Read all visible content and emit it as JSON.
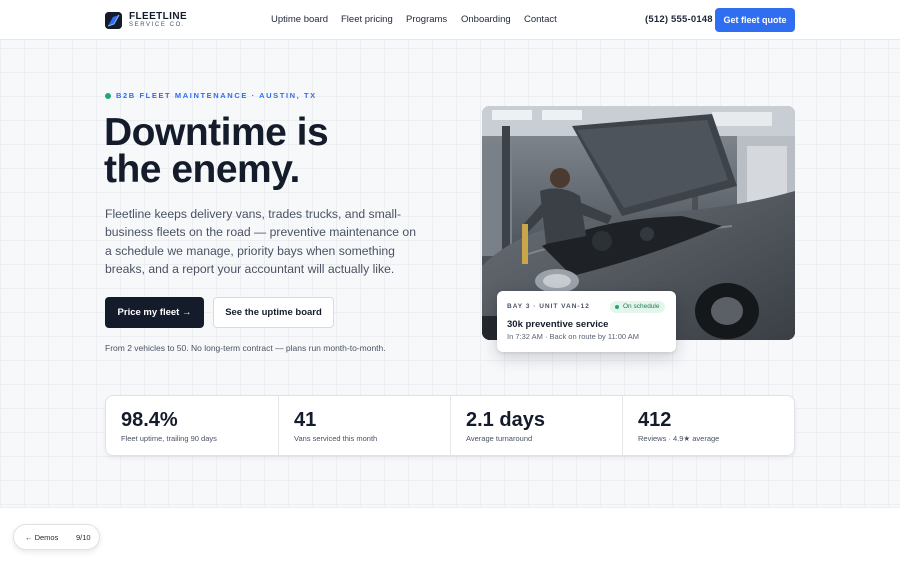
{
  "nav": {
    "logo_name": "FLEETLINE",
    "logo_sub": "SERVICE CO.",
    "links": [
      "Uptime board",
      "Fleet pricing",
      "Programs",
      "Onboarding",
      "Contact"
    ],
    "phone": "(512) 555-0148",
    "cta": "Get fleet quote"
  },
  "hero": {
    "eyebrow": "B2B FLEET MAINTENANCE · AUSTIN, TX",
    "headline_line1": "Downtime is",
    "headline_line2": "the enemy.",
    "lede": "Fleetline keeps delivery vans, trades trucks, and small-business fleets on the road — preventive maintenance on a schedule we manage, priority bays when something breaks, and a report your accountant will actually like.",
    "primary_button": "Price my fleet →",
    "secondary_button": "See the uptime board",
    "fineprint": "From 2 vehicles to 50. No long-term contract — plans run month-to-month."
  },
  "status_card": {
    "bay": "BAY 3 · UNIT VAN-12",
    "badge": "On schedule",
    "title": "30k preventive service",
    "subtitle": "In 7:32 AM · Back on route by 11:00 AM"
  },
  "stats": [
    {
      "value": "98.4%",
      "label": "Fleet uptime, trailing 90 days"
    },
    {
      "value": "41",
      "label": "Vans serviced this month"
    },
    {
      "value": "2.1 days",
      "label": "Average turnaround"
    },
    {
      "value": "412",
      "label": "Reviews · 4.9★ average"
    }
  ],
  "demo": {
    "back": "← Demos",
    "count": "9/10"
  },
  "colors": {
    "accent": "#2f6df1",
    "ink": "#141c2b",
    "success": "#1fa971"
  }
}
